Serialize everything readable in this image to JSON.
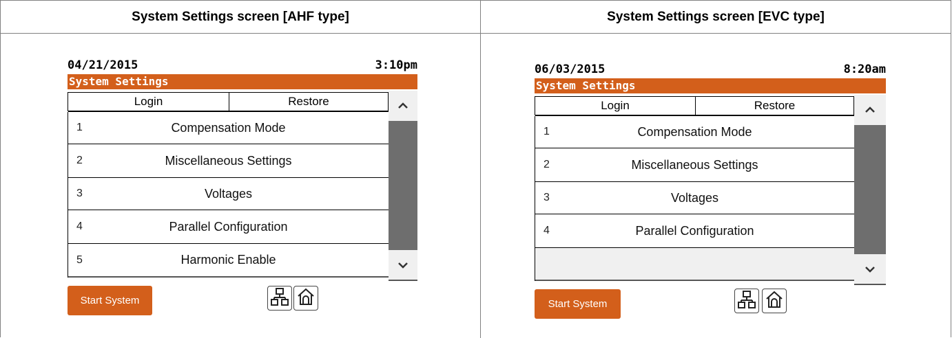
{
  "headers": {
    "left": "System Settings screen [AHF type]",
    "right": "System Settings screen [EVC type]"
  },
  "ahf": {
    "date": "04/21/2015",
    "time": "3:10pm",
    "title": "System Settings",
    "tabs": {
      "login": "Login",
      "restore": "Restore"
    },
    "items": [
      {
        "num": "1",
        "label": "Compensation Mode"
      },
      {
        "num": "2",
        "label": "Miscellaneous Settings"
      },
      {
        "num": "3",
        "label": "Voltages"
      },
      {
        "num": "4",
        "label": "Parallel Configuration"
      },
      {
        "num": "5",
        "label": "Harmonic Enable"
      }
    ],
    "start_label": "Start System"
  },
  "evc": {
    "date": "06/03/2015",
    "time": "8:20am",
    "title": "System Settings",
    "tabs": {
      "login": "Login",
      "restore": "Restore"
    },
    "items": [
      {
        "num": "1",
        "label": "Compensation Mode"
      },
      {
        "num": "2",
        "label": "Miscellaneous Settings"
      },
      {
        "num": "3",
        "label": "Voltages"
      },
      {
        "num": "4",
        "label": "Parallel Configuration"
      }
    ],
    "start_label": "Start System"
  },
  "icons": [
    "scroll-up-icon",
    "scroll-down-icon",
    "network-icon",
    "home-icon"
  ],
  "colors": {
    "accent": "#d35f1b",
    "scroll_thumb": "#6e6e6e",
    "border": "#808080"
  }
}
